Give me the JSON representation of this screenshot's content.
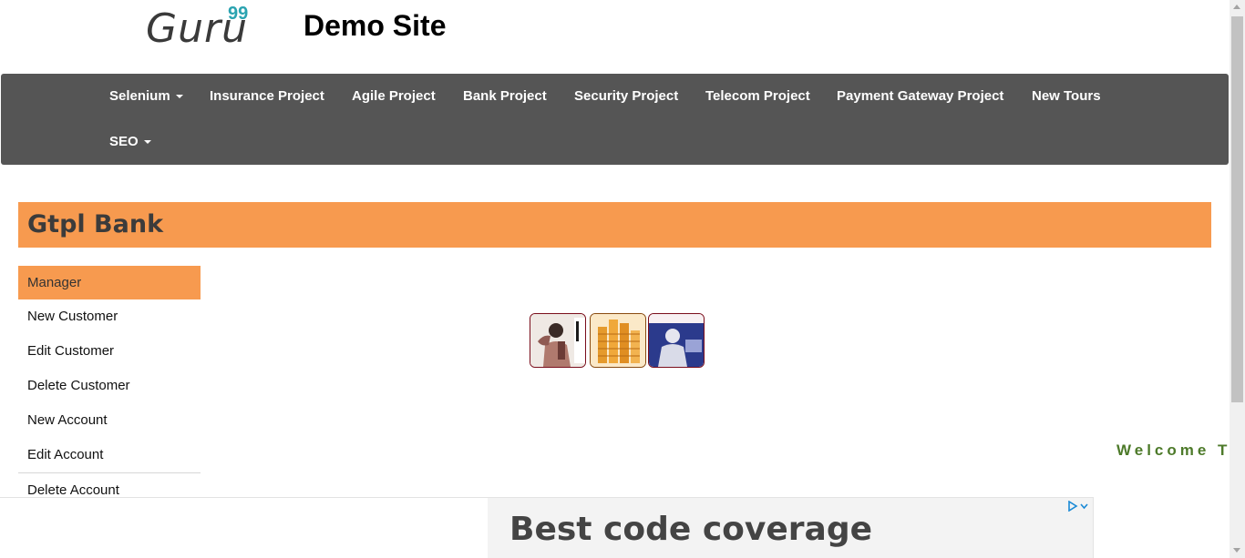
{
  "header": {
    "logo_text": "Guru",
    "logo_superscript": "99",
    "site_title": "Demo Site"
  },
  "nav": {
    "items": [
      {
        "label": "Selenium",
        "dropdown": true
      },
      {
        "label": "Insurance Project",
        "dropdown": false
      },
      {
        "label": "Agile Project",
        "dropdown": false
      },
      {
        "label": "Bank Project",
        "dropdown": false
      },
      {
        "label": "Security Project",
        "dropdown": false
      },
      {
        "label": "Telecom Project",
        "dropdown": false
      },
      {
        "label": "Payment Gateway Project",
        "dropdown": false
      },
      {
        "label": "New Tours",
        "dropdown": false
      },
      {
        "label": "SEO",
        "dropdown": true
      }
    ]
  },
  "bank": {
    "title": "Gtpl Bank"
  },
  "menu": {
    "items": [
      {
        "label": "Manager",
        "active": true
      },
      {
        "label": "New Customer"
      },
      {
        "label": "Edit Customer"
      },
      {
        "label": "Delete Customer"
      },
      {
        "label": "New Account"
      },
      {
        "label": "Edit Account"
      },
      {
        "label": "Delete Account"
      }
    ]
  },
  "marquee": {
    "text": "Welcome T"
  },
  "ad": {
    "headline": "Best code coverage",
    "choices_icon": "ad-choices-icon"
  },
  "colors": {
    "navbar": "#555555",
    "accent": "#f79a4f",
    "logo_sup": "#2aa3b0",
    "welcome": "#4d7a2a"
  }
}
